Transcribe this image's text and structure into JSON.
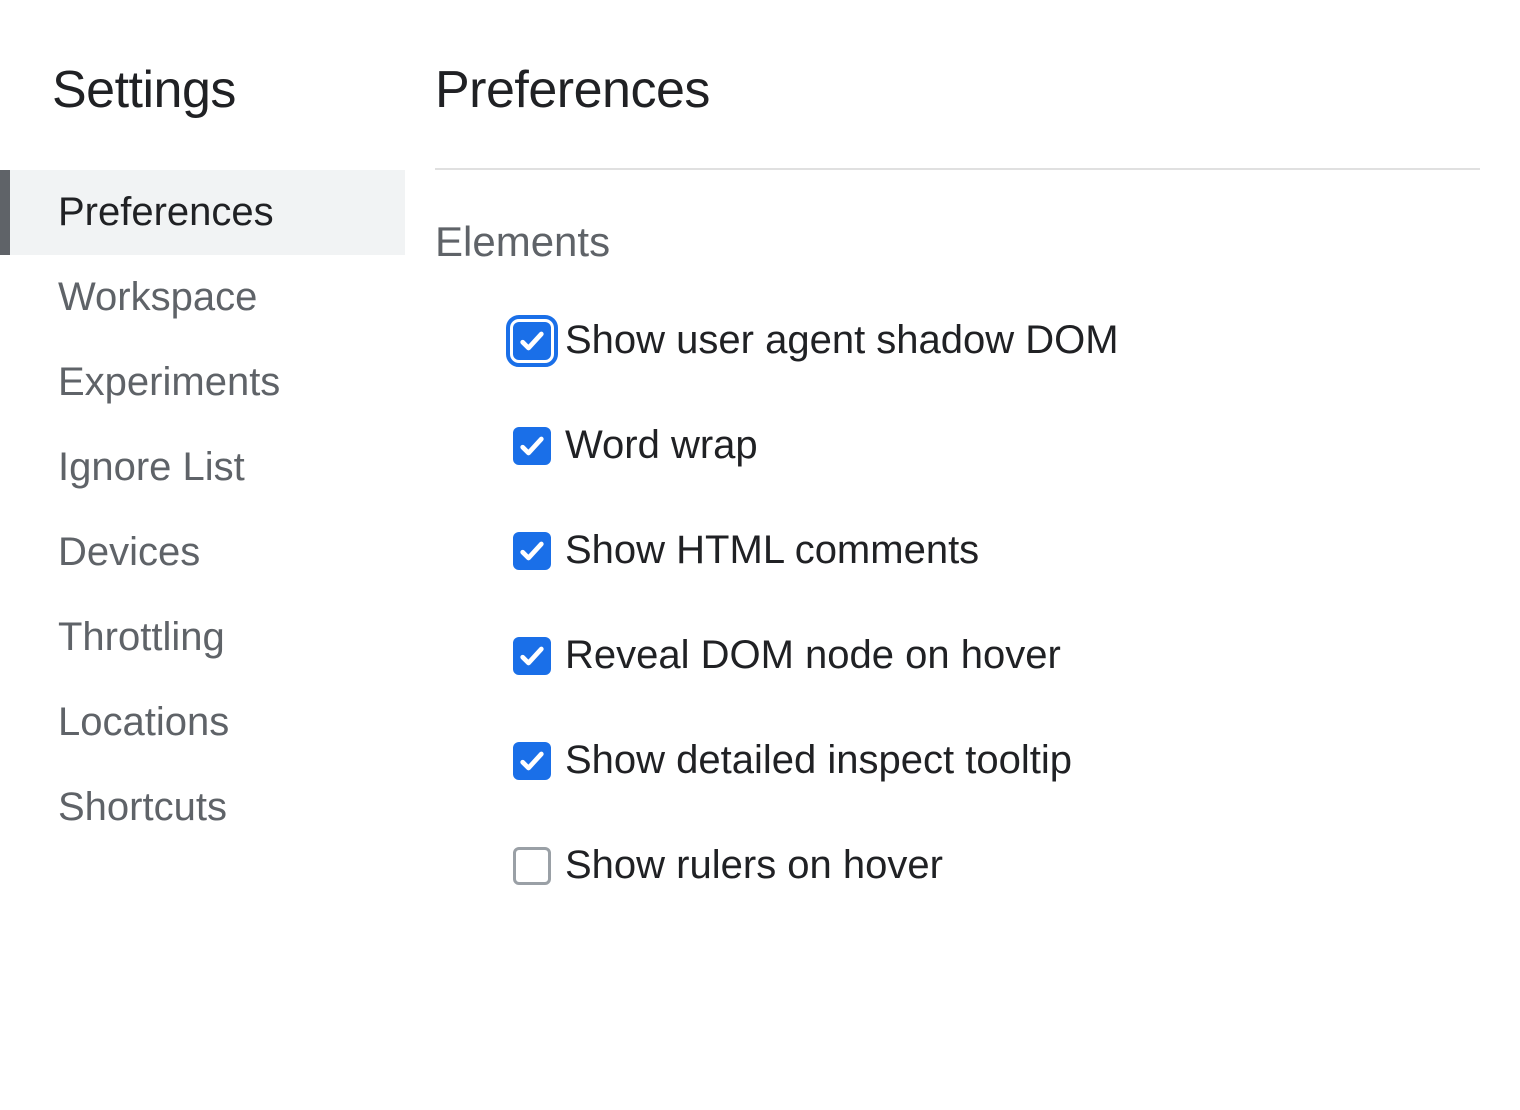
{
  "sidebar": {
    "title": "Settings",
    "items": [
      {
        "label": "Preferences",
        "active": true
      },
      {
        "label": "Workspace",
        "active": false
      },
      {
        "label": "Experiments",
        "active": false
      },
      {
        "label": "Ignore List",
        "active": false
      },
      {
        "label": "Devices",
        "active": false
      },
      {
        "label": "Throttling",
        "active": false
      },
      {
        "label": "Locations",
        "active": false
      },
      {
        "label": "Shortcuts",
        "active": false
      }
    ]
  },
  "main": {
    "title": "Preferences",
    "section": {
      "title": "Elements",
      "options": [
        {
          "label": "Show user agent shadow DOM",
          "checked": true,
          "focused": true
        },
        {
          "label": "Word wrap",
          "checked": true,
          "focused": false
        },
        {
          "label": "Show HTML comments",
          "checked": true,
          "focused": false
        },
        {
          "label": "Reveal DOM node on hover",
          "checked": true,
          "focused": false
        },
        {
          "label": "Show detailed inspect tooltip",
          "checked": true,
          "focused": false
        },
        {
          "label": "Show rulers on hover",
          "checked": false,
          "focused": false
        }
      ]
    }
  }
}
